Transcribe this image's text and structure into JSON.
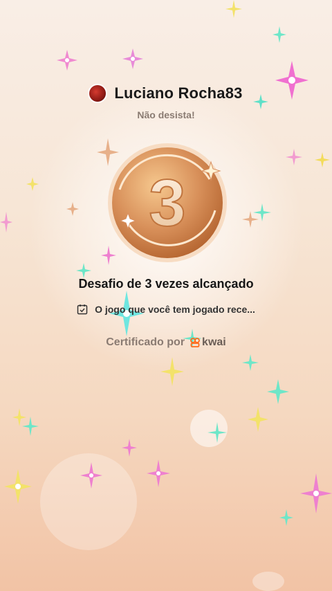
{
  "user": {
    "name": "Luciano Rocha83",
    "subtitle": "Não desista!"
  },
  "badge": {
    "number": "3",
    "title": "Desafio de 3 vezes alcançado"
  },
  "description": "O jogo que você tem jogado rece...",
  "certificate": {
    "label": "Certificado por",
    "brand": "kwai"
  },
  "colors": {
    "medal": "#d8905a",
    "brand": "#ff6a1a",
    "background": "#f7e6d6"
  },
  "icons": {
    "avatar": "avatar-icon",
    "calendar": "calendar-check-icon",
    "logo": "kwai-logo-icon"
  }
}
